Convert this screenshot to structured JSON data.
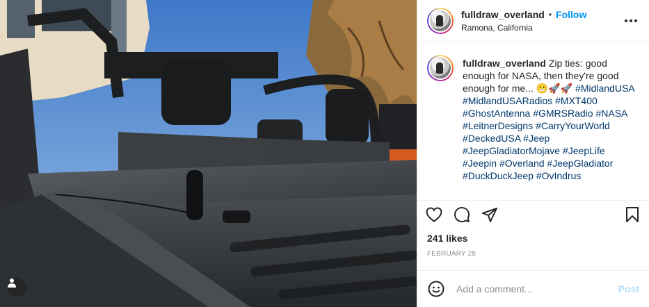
{
  "post": {
    "username": "fulldraw_overland",
    "dot": "•",
    "follow_label": "Follow",
    "location": "Ramona, California",
    "caption_text": "Zip ties: good enough for NASA, then they're good enough for me... 😬🚀🚀",
    "hashtags": [
      "#MidlandUSA",
      "#MidlandUSARadios",
      "#MXT400",
      "#GhostAntenna",
      "#GMRSRadio",
      "#NASA",
      "#LeitnerDesigns",
      "#CarryYourWorld",
      "#DeckedUSA",
      "#Jeep",
      "#JeepGladiatorMojave",
      "#JeepLife",
      "#Jeepin",
      "#Overland",
      "#JeepGladiator",
      "#DuckDuckJeep",
      "#OvIndrus"
    ],
    "likes": "241 likes",
    "date": "FEBRUARY 28"
  },
  "comment": {
    "placeholder": "Add a comment...",
    "post_label": "Post"
  },
  "icons": {
    "more": "more-options-icon",
    "like": "heart-icon",
    "comment": "comment-icon",
    "share": "share-icon",
    "save": "bookmark-icon",
    "emoji": "emoji-icon",
    "user_tag": "user-tag-icon"
  },
  "colors": {
    "link": "#0095f6",
    "hashtag": "#00376b",
    "post_disabled": "#b2dffc",
    "muted": "#8e8e8e"
  }
}
